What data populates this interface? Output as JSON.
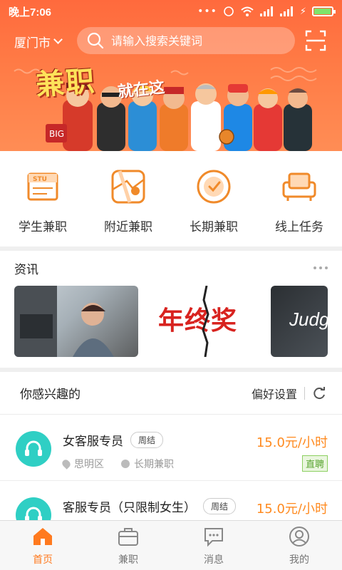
{
  "status": {
    "time": "晚上7:06"
  },
  "header": {
    "city": "厦门市",
    "search_placeholder": "请输入搜索关键词",
    "banner_title": "兼职",
    "banner_subtitle": "就在这",
    "banner_sign": "BIG"
  },
  "categories": [
    {
      "label": "学生兼职",
      "icon": "student-card-icon"
    },
    {
      "label": "附近兼职",
      "icon": "map-icon"
    },
    {
      "label": "长期兼职",
      "icon": "clock-icon"
    },
    {
      "label": "线上任务",
      "icon": "sofa-icon"
    }
  ],
  "news": {
    "title": "资讯",
    "cards": [
      {
        "text": "",
        "image": "stressed-man-at-computer"
      },
      {
        "text": "年终奖"
      },
      {
        "text": "Judg"
      }
    ]
  },
  "interest": {
    "title": "你感兴趣的",
    "preference_label": "偏好设置",
    "jobs": [
      {
        "title": "女客服专员",
        "tag": "周结",
        "location": "思明区",
        "duration": "长期兼职",
        "price": "15.0元/小时",
        "badge": "直聘"
      },
      {
        "title": "客服专员（只限制女生）",
        "tag": "周结",
        "price": "15.0元/小时"
      }
    ]
  },
  "tabs": [
    {
      "label": "首页",
      "active": true
    },
    {
      "label": "兼职"
    },
    {
      "label": "消息"
    },
    {
      "label": "我的"
    }
  ],
  "colors": {
    "accent": "#ff7a1f",
    "header": "#ff7040",
    "avatar": "#2fcfc4",
    "badge_green": "#5aa532"
  }
}
